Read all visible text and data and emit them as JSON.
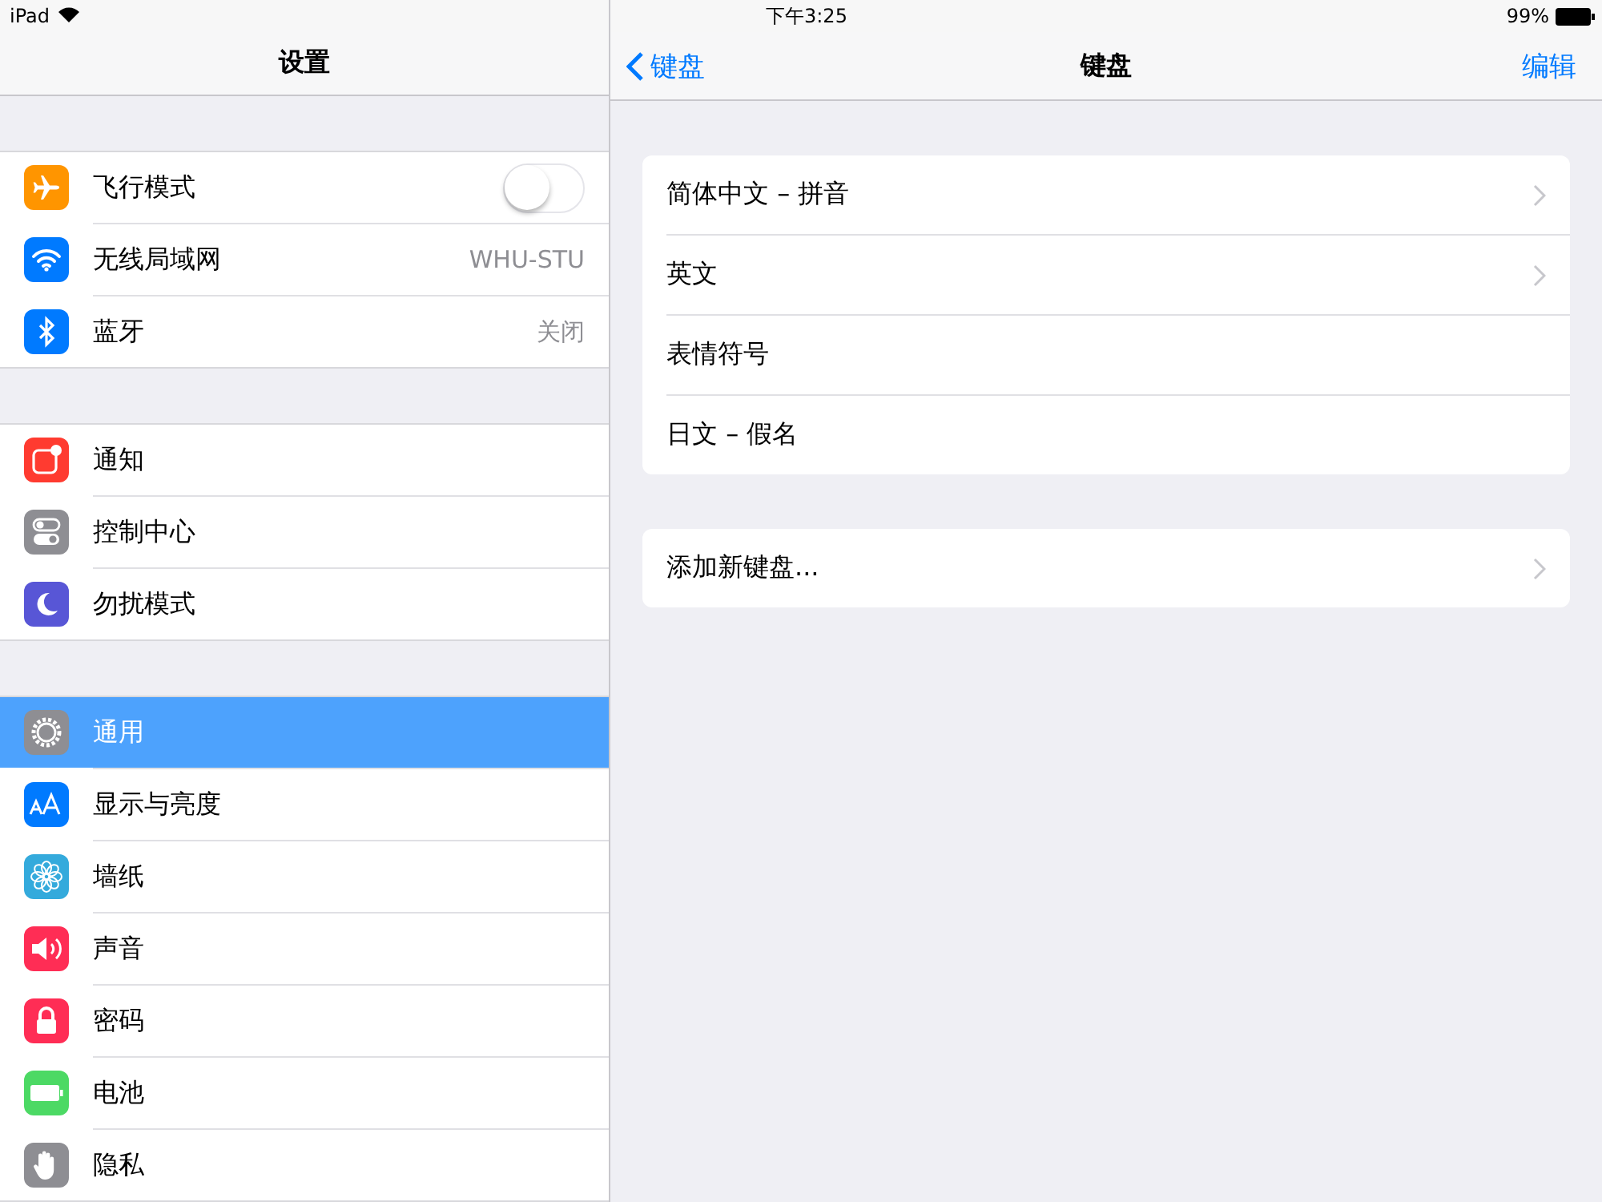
{
  "status_bar": {
    "device": "iPad",
    "time": "下午3:25",
    "battery": "99%"
  },
  "sidebar": {
    "title": "设置",
    "groups": [
      [
        {
          "label": "飞行模式",
          "color": "#ff9500",
          "kind": "toggle",
          "on": false,
          "selected": false
        },
        {
          "label": "无线局域网",
          "color": "#007aff",
          "kind": "value",
          "value": "WHU-STU",
          "selected": false
        },
        {
          "label": "蓝牙",
          "color": "#007aff",
          "kind": "value",
          "value": "关闭",
          "selected": false
        }
      ],
      [
        {
          "label": "通知",
          "color": "#ff3b30",
          "kind": "plain",
          "selected": false
        },
        {
          "label": "控制中心",
          "color": "#8e8e93",
          "kind": "plain",
          "selected": false
        },
        {
          "label": "勿扰模式",
          "color": "#5856d6",
          "kind": "plain",
          "selected": false
        }
      ],
      [
        {
          "label": "通用",
          "color": "#8e8e93",
          "kind": "plain",
          "selected": true
        },
        {
          "label": "显示与亮度",
          "color": "#007aff",
          "kind": "plain",
          "selected": false
        },
        {
          "label": "墙纸",
          "color": "#34aadc",
          "kind": "plain",
          "selected": false
        },
        {
          "label": "声音",
          "color": "#ff2d55",
          "kind": "plain",
          "selected": false
        },
        {
          "label": "密码",
          "color": "#ff2d55",
          "kind": "plain",
          "selected": false
        },
        {
          "label": "电池",
          "color": "#4cd964",
          "kind": "plain",
          "selected": false
        },
        {
          "label": "隐私",
          "color": "#8e8e93",
          "kind": "plain",
          "selected": false
        }
      ]
    ]
  },
  "detail": {
    "back": "键盘",
    "title": "键盘",
    "edit": "编辑",
    "groups": [
      [
        {
          "label": "简体中文 – 拼音",
          "chevron": true
        },
        {
          "label": "英文",
          "chevron": true
        },
        {
          "label": "表情符号",
          "chevron": false
        },
        {
          "label": "日文 – 假名",
          "chevron": false
        }
      ],
      [
        {
          "label": "添加新键盘...",
          "chevron": true
        }
      ]
    ]
  }
}
